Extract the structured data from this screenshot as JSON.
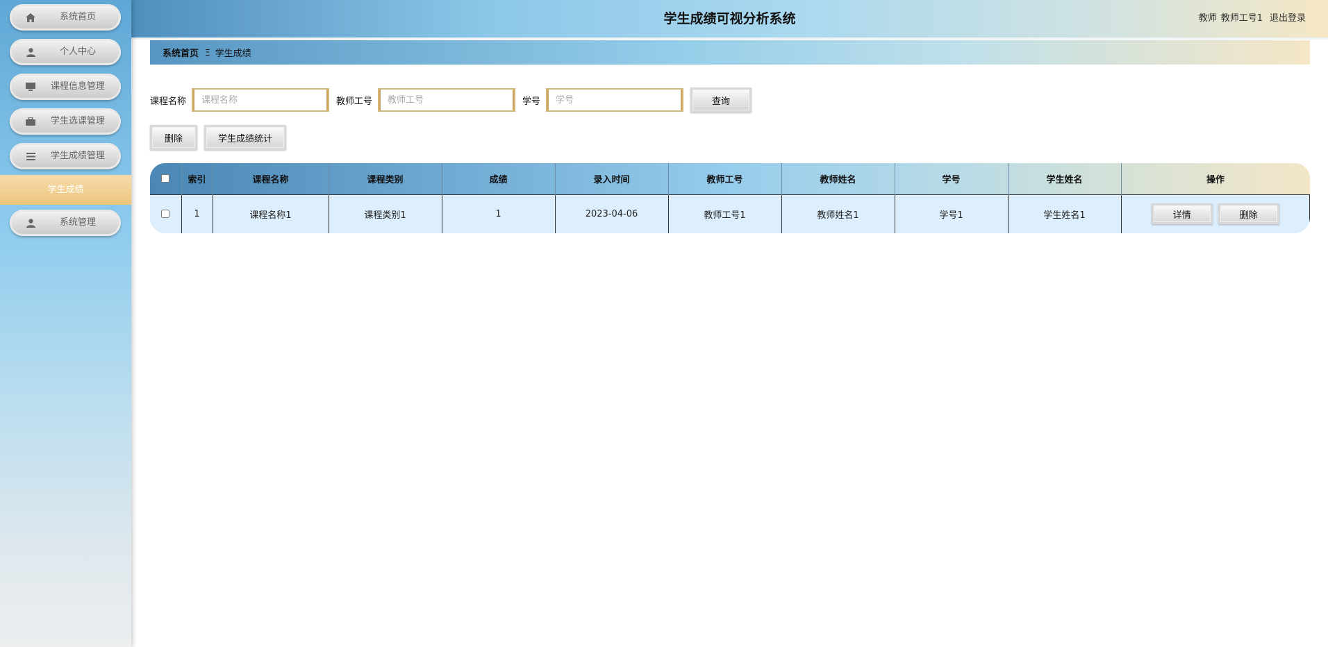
{
  "app": {
    "title": "学生成绩可视分析系统",
    "user_role": "教师",
    "user_name": "教师工号1",
    "logout_label": "退出登录"
  },
  "sidebar": {
    "items": [
      {
        "label": "系统首页",
        "icon": "home-icon"
      },
      {
        "label": "个人中心",
        "icon": "user-icon"
      },
      {
        "label": "课程信息管理",
        "icon": "monitor-icon"
      },
      {
        "label": "学生选课管理",
        "icon": "briefcase-icon"
      },
      {
        "label": "学生成绩管理",
        "icon": "list-icon"
      },
      {
        "label": "系统管理",
        "icon": "user-icon"
      }
    ],
    "active_sub_item": "学生成绩"
  },
  "breadcrumb": {
    "home": "系统首页",
    "separator": "Ξ",
    "current": "学生成绩"
  },
  "search": {
    "course_label": "课程名称",
    "course_placeholder": "课程名称",
    "teacher_label": "教师工号",
    "teacher_placeholder": "教师工号",
    "student_label": "学号",
    "student_placeholder": "学号",
    "query_label": "查询"
  },
  "actions": {
    "delete_label": "删除",
    "stats_label": "学生成绩统计"
  },
  "table": {
    "columns": [
      "索引",
      "课程名称",
      "课程类别",
      "成绩",
      "录入时间",
      "教师工号",
      "教师姓名",
      "学号",
      "学生姓名",
      "操作"
    ],
    "rows": [
      {
        "index": "1",
        "course_name": "课程名称1",
        "course_type": "课程类别1",
        "score": "1",
        "entry_time": "2023-04-06",
        "teacher_id": "教师工号1",
        "teacher_name": "教师姓名1",
        "student_id": "学号1",
        "student_name": "学生姓名1",
        "detail_label": "详情",
        "delete_label": "删除"
      }
    ]
  },
  "colors": {
    "accent_gold": "#edc57f",
    "header_blue": "#4f8fbe",
    "row_background": "#ddeefc"
  }
}
